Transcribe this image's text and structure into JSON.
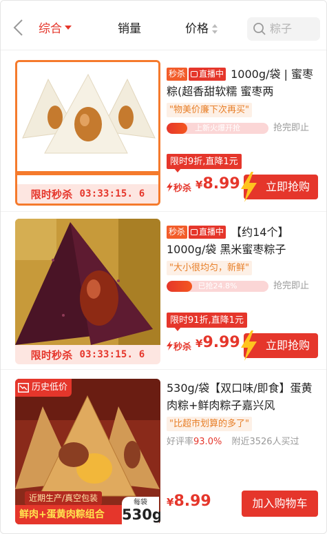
{
  "header": {
    "tabs": [
      "综合",
      "销量",
      "价格"
    ],
    "search_placeholder": "粽子"
  },
  "colors": {
    "accent": "#e5362b",
    "orange": "#f25c2a",
    "quote_text": "#e8802a"
  },
  "products": [
    {
      "tags": [
        "秒杀",
        "直播中"
      ],
      "title": "1000g/袋 | 蜜枣粽(超香甜软糯 蜜枣两",
      "quote": "\"物美价廉下次再买\"",
      "progress_text": "上新火爆开抢",
      "progress_fraction": 0.2,
      "progress_status": "抢完即止",
      "discount": "限时9折,直降1元",
      "price_label": "秒杀",
      "price_yen": "¥",
      "price": "8.99",
      "button": "立即抢购",
      "flash_label": "限时秒杀",
      "timer": "03:33:15. 6"
    },
    {
      "tags": [
        "秒杀",
        "直播中"
      ],
      "title": "【约14个】1000g/袋 黑米蜜枣粽子",
      "quote": "\"大小很均匀，新鲜\"",
      "progress_text": "已抢24.8%",
      "progress_fraction": 0.248,
      "progress_status": "抢完即止",
      "discount": "限时91折,直降1元",
      "price_label": "秒杀",
      "price_yen": "¥",
      "price": "9.99",
      "button": "立即抢购",
      "flash_label": "限时秒杀",
      "timer": "03:33:15. 6"
    },
    {
      "title": "530g/袋【双口味/即食】蛋黄肉粽+鲜肉粽子嘉兴风",
      "quote": "\"比超市划算的多了\"",
      "rating_label": "好评率",
      "rating_value": "93.0%",
      "sales": "附近3526人买过",
      "price_yen": "¥",
      "price": "8.99",
      "button": "加入购物车",
      "hist_tag": "历史低价",
      "promo_line1": "近期生产/真空包装",
      "promo_line2": "鲜肉+蛋黄肉粽组合",
      "weight_small": "每袋",
      "weight_big": "530g"
    }
  ]
}
